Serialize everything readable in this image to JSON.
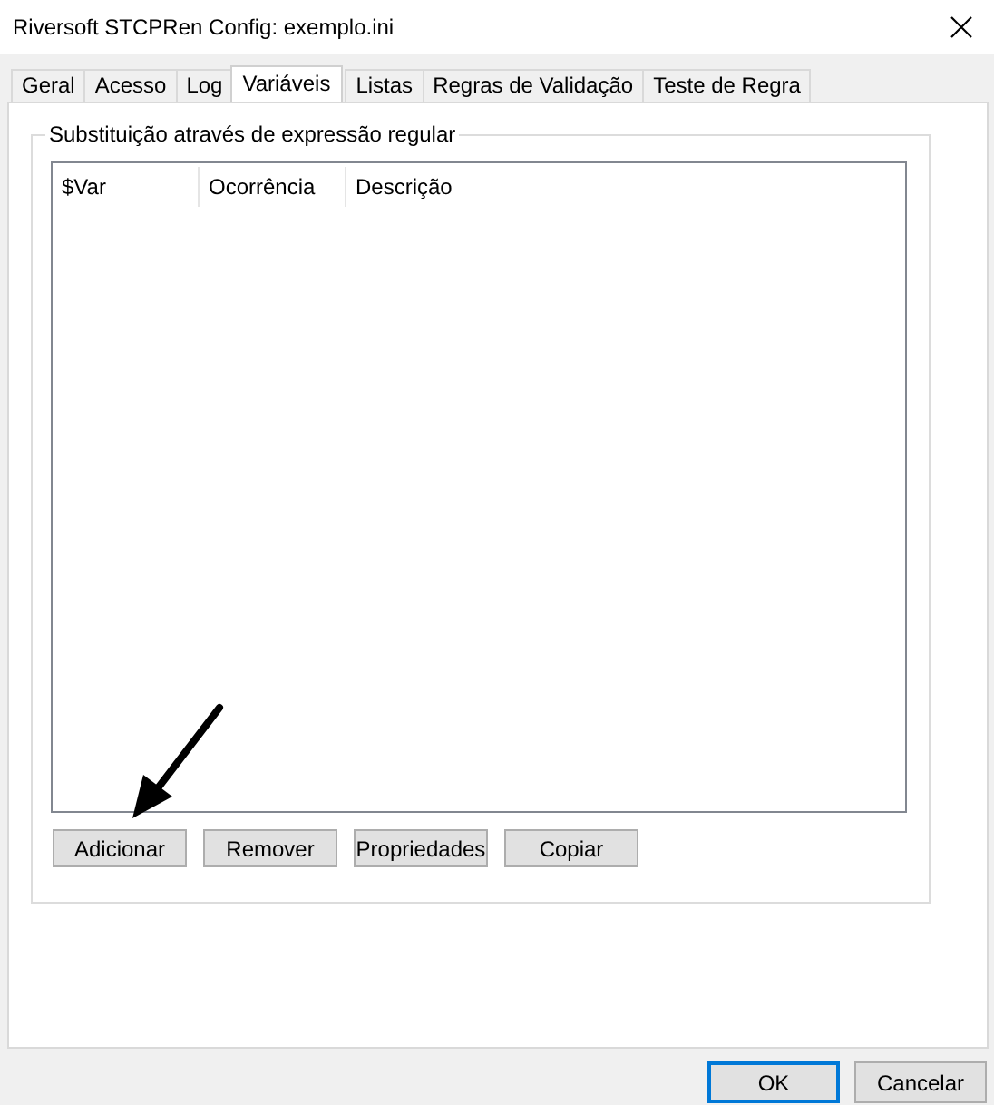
{
  "window": {
    "title": "Riversoft STCPRen Config: exemplo.ini"
  },
  "tabs": [
    {
      "label": "Geral",
      "selected": false
    },
    {
      "label": "Acesso",
      "selected": false
    },
    {
      "label": "Log",
      "selected": false
    },
    {
      "label": "Variáveis",
      "selected": true
    },
    {
      "label": "Listas",
      "selected": false
    },
    {
      "label": "Regras de Validação",
      "selected": false
    },
    {
      "label": "Teste de Regra",
      "selected": false
    }
  ],
  "group": {
    "title": "Substituição através de expressão regular",
    "table": {
      "columns": [
        "$Var",
        "Ocorrência",
        "Descrição"
      ]
    },
    "buttons": [
      "Adicionar",
      "Remover",
      "Propriedades",
      "Copiar"
    ]
  },
  "dialog_buttons": [
    {
      "label": "OK",
      "default": true
    },
    {
      "label": "Cancelar",
      "default": false
    }
  ]
}
